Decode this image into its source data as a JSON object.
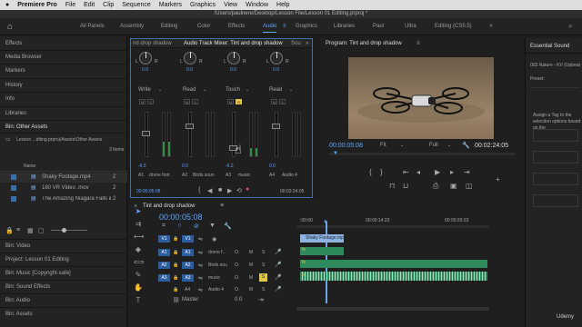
{
  "menu": {
    "apple": "",
    "app": "Premiere Pro",
    "items": [
      "File",
      "Edit",
      "Clip",
      "Sequence",
      "Markers",
      "Graphics",
      "View",
      "Window",
      "Help"
    ]
  },
  "title_path": "/Users/paulnere/Desktop/Lesson File/Lesson 01 Editing.prproj *",
  "workspaces": [
    "All Panels",
    "Assembly",
    "Editing",
    "Color",
    "Effects",
    "Audio",
    "Graphics",
    "Libraries",
    "Paul",
    "Ultra",
    "Editing (CS5.5)"
  ],
  "workspace_active": "Audio",
  "left_panels": [
    "Effects",
    "Media Browser",
    "Markers",
    "History",
    "Info",
    "Libraries"
  ],
  "bin": {
    "title": "Bin: Other Assets",
    "path": "Lesson ...diting.prproj\\Assets\\Other Assets",
    "count": "3 Items",
    "column_name": "Name",
    "items": [
      {
        "name": "Shaky Footage.mp4",
        "num": "2"
      },
      {
        "name": "180 VR Video .mov",
        "num": "2"
      },
      {
        "name": "The Amazing Niagara Falls in",
        "num": "2"
      }
    ]
  },
  "bins_list": [
    "Bin: Video",
    "Project: Lesson 01 Editing",
    "Bin: Music [Copyright-safe]",
    "Bin: Sound Effects",
    "Bin: Audio",
    "Bin: Assets"
  ],
  "mixer": {
    "tabs": [
      "nd drop shadow",
      "Audio Track Mixer: Tint and drop shadow",
      "Sou"
    ],
    "channels": [
      {
        "pan": "0.0",
        "mode": "Write",
        "vol": "-6.5",
        "name": "drone foot"
      },
      {
        "pan": "0.0",
        "mode": "Read",
        "vol": "0.0",
        "name": "Birds soun"
      },
      {
        "pan": "0.0",
        "mode": "Touch",
        "vol": "-6.2",
        "name": "music"
      },
      {
        "pan": "0.0",
        "mode": "Read",
        "vol": "0.0",
        "name": "Audio 4"
      }
    ],
    "tracks": [
      "A1",
      "A2",
      "A3",
      "A4"
    ],
    "time_in": "00:00:05:08",
    "time_out": "00:02:24:05",
    "lr": "L R",
    "btns": [
      "M",
      "S",
      "R"
    ],
    "scale": [
      "dB",
      "-6",
      "-12",
      "-18",
      "-24",
      "-30",
      "-36",
      "-42",
      "-48",
      "-54"
    ]
  },
  "program": {
    "title": "Program: Tint and drop shadow",
    "timecode": "00:00:05:08",
    "fit": "Fit",
    "quality": "Full",
    "duration": "00:02:24:05"
  },
  "timeline": {
    "title": "Tint and drop shadow",
    "timecode": "00:00:05:08",
    "ruler": [
      ":00:00",
      "00:00:14:23",
      "00:00:29:23"
    ],
    "video_track": {
      "src": "V1",
      "name": "V1"
    },
    "audio_tracks": [
      {
        "src": "A1",
        "name": "A1",
        "label": "drone f...",
        "level": "O."
      },
      {
        "src": "A2",
        "name": "A2",
        "label": "Birds sou",
        "level": "O."
      },
      {
        "src": "A3",
        "name": "A3",
        "label": "music",
        "level": "O."
      },
      {
        "src": "A4",
        "name": "A4",
        "label": "Audio 4",
        "level": "O."
      }
    ],
    "master": "Master",
    "master_level": "0.0",
    "clip_label": "Shaky Footage.mp",
    "fx_label": "fx"
  },
  "essential_sound": {
    "title": "Essential Sound",
    "preset_row": "003 Nature - KV (Upbeat",
    "preset_label": "Preset:",
    "hint": "Assign a Tag to the selection options based on the"
  },
  "watermark": "Udemy",
  "colors": {
    "accent": "#5fa6ff",
    "highlight": "#e4c545",
    "audio_clip": "#2e8a5a",
    "video_clip": "#8fb3e0"
  }
}
